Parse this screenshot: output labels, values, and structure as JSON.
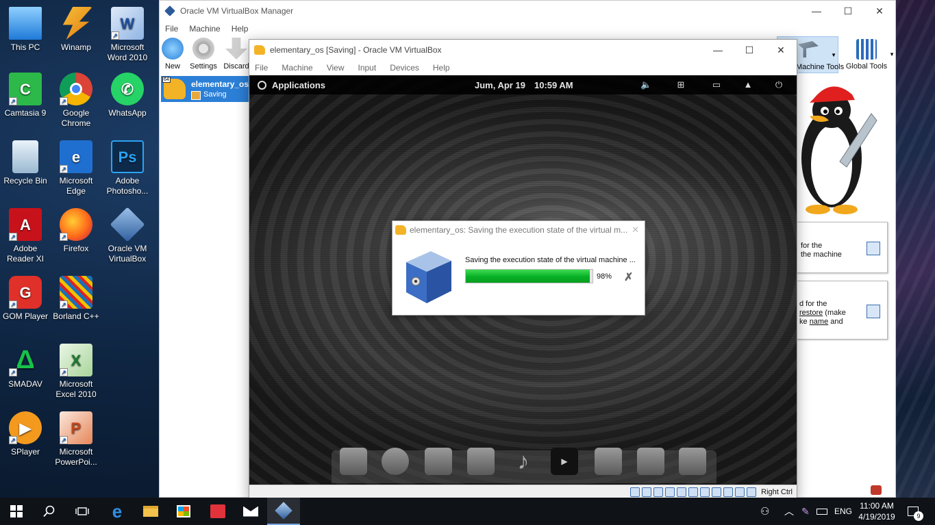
{
  "desktop": {
    "icons": [
      {
        "label": "This PC"
      },
      {
        "label": "Winamp"
      },
      {
        "label": "Microsoft Word 2010"
      },
      {
        "label": "Camtasia 9"
      },
      {
        "label": "Google Chrome"
      },
      {
        "label": "WhatsApp"
      },
      {
        "label": "Recycle Bin"
      },
      {
        "label": "Microsoft Edge"
      },
      {
        "label": "Adobe Photosho..."
      },
      {
        "label": "Adobe Reader XI"
      },
      {
        "label": "Firefox"
      },
      {
        "label": "Oracle VM VirtualBox"
      },
      {
        "label": "GOM Player"
      },
      {
        "label": "Borland C++"
      },
      {
        "label": "SMADAV"
      },
      {
        "label": "Microsoft Excel 2010"
      },
      {
        "label": "SPlayer"
      },
      {
        "label": "Microsoft PowerPoi..."
      }
    ]
  },
  "manager": {
    "title": "Oracle VM VirtualBox Manager",
    "menu": [
      "File",
      "Machine",
      "Help"
    ],
    "toolbar": {
      "new": "New",
      "settings": "Settings",
      "discard": "Discard"
    },
    "vm": {
      "name": "elementary_os",
      "state": "Saving"
    },
    "machine_tools": "Machine Tools",
    "global_tools": "Global Tools",
    "card1": {
      "line1": "for the",
      "line2": "the machine"
    },
    "card2": {
      "line1": "d for the",
      "line2a": "restore",
      "line2b": " (make",
      "line3a": "ke ",
      "line3b": "name",
      "line3c": " and"
    }
  },
  "vmwindow": {
    "title": "elementary_os [Saving] - Oracle VM VirtualBox",
    "menu": [
      "File",
      "Machine",
      "View",
      "Input",
      "Devices",
      "Help"
    ],
    "guest": {
      "applications": "Applications",
      "date": "Jum, Apr 19",
      "time": "10:59 AM"
    },
    "status": {
      "host_key": "Right Ctrl"
    }
  },
  "dialog": {
    "title": "elementary_os: Saving the execution state of the virtual m...",
    "message": "Saving the execution state of the virtual machine ...",
    "progress_percent": 98,
    "progress_label": "98%"
  },
  "taskbar": {
    "language": "ENG",
    "time": "11:00 AM",
    "date": "4/19/2019",
    "notifications": "9"
  },
  "colors": {
    "selection": "#2b7fd6",
    "progress": "#06b025",
    "taskbar": "#0f1318"
  }
}
